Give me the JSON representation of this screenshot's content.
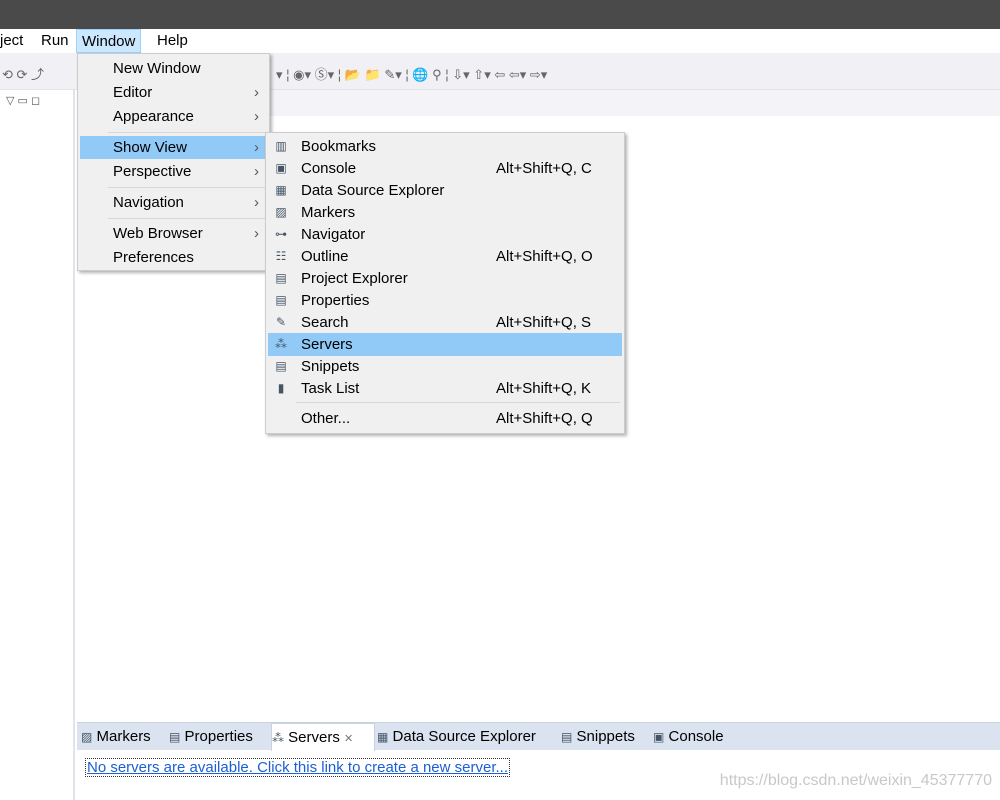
{
  "menubar": {
    "items": [
      "ject",
      "Run",
      "Window",
      "Help"
    ]
  },
  "window_menu": {
    "items": [
      {
        "label": "New Window"
      },
      {
        "label": "Editor",
        "submenu": true
      },
      {
        "label": "Appearance",
        "submenu": true
      },
      {
        "label": "Show View",
        "submenu": true,
        "selected": true
      },
      {
        "label": "Perspective",
        "submenu": true
      },
      {
        "label": "Navigation",
        "submenu": true
      },
      {
        "label": "Web Browser",
        "submenu": true
      },
      {
        "label": "Preferences"
      }
    ]
  },
  "show_view_menu": {
    "items": [
      {
        "label": "Bookmarks",
        "icon": "bookmarks-icon",
        "shortcut": ""
      },
      {
        "label": "Console",
        "icon": "console-icon",
        "shortcut": "Alt+Shift+Q, C"
      },
      {
        "label": "Data Source Explorer",
        "icon": "data-source-icon",
        "shortcut": ""
      },
      {
        "label": "Markers",
        "icon": "markers-icon",
        "shortcut": ""
      },
      {
        "label": "Navigator",
        "icon": "navigator-icon",
        "shortcut": ""
      },
      {
        "label": "Outline",
        "icon": "outline-icon",
        "shortcut": "Alt+Shift+Q, O"
      },
      {
        "label": "Project Explorer",
        "icon": "project-explorer-icon",
        "shortcut": ""
      },
      {
        "label": "Properties",
        "icon": "properties-icon",
        "shortcut": ""
      },
      {
        "label": "Search",
        "icon": "search-icon",
        "shortcut": "Alt+Shift+Q, S"
      },
      {
        "label": "Servers",
        "icon": "servers-icon",
        "shortcut": "",
        "selected": true
      },
      {
        "label": "Snippets",
        "icon": "snippets-icon",
        "shortcut": ""
      },
      {
        "label": "Task List",
        "icon": "task-list-icon",
        "shortcut": "Alt+Shift+Q, K"
      },
      {
        "label": "Other...",
        "icon": "",
        "shortcut": "Alt+Shift+Q, Q"
      }
    ]
  },
  "bottom": {
    "tabs": [
      "Markers",
      "Properties",
      "Servers",
      "Data Source Explorer",
      "Snippets",
      "Console"
    ],
    "active_tab": "Servers",
    "link": "No servers are available. Click this link to create a new server...",
    "watermark": "https://blog.csdn.net/weixin_45377770"
  },
  "colors": {
    "selection": "#91c9f7",
    "link": "#1a5fd6",
    "titlebar": "#4a4a4a"
  }
}
